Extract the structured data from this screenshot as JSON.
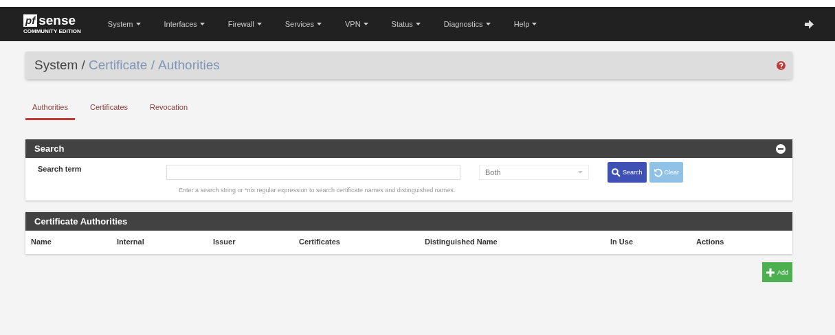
{
  "navbar": {
    "logo": {
      "mark": "pf",
      "name": "sense",
      "edition": "COMMUNITY EDITION"
    },
    "menus": [
      "System",
      "Interfaces",
      "Firewall",
      "Services",
      "VPN",
      "Status",
      "Diagnostics",
      "Help"
    ]
  },
  "breadcrumb": {
    "root": "System /",
    "links": [
      "Certificate /",
      "Authorities"
    ]
  },
  "tabs": [
    {
      "label": "Authorities",
      "selected": true
    },
    {
      "label": "Certificates",
      "selected": false
    },
    {
      "label": "Revocation",
      "selected": false
    }
  ],
  "search_panel": {
    "title": "Search",
    "label": "Search term",
    "select": {
      "value": "Both"
    },
    "buttons": [
      {
        "kind": "search",
        "label": "Search"
      },
      {
        "kind": "clear",
        "label": "Clear"
      }
    ],
    "help": "Enter a search string or *nix regular expression to search certificate names and distinguished names."
  },
  "table": {
    "title": "Certificate Authorities",
    "columns": [
      "Name",
      "Internal",
      "Issuer",
      "Certificates",
      "Distinguished Name",
      "In Use",
      "Actions"
    ]
  },
  "add_button": {
    "label": "Add"
  }
}
